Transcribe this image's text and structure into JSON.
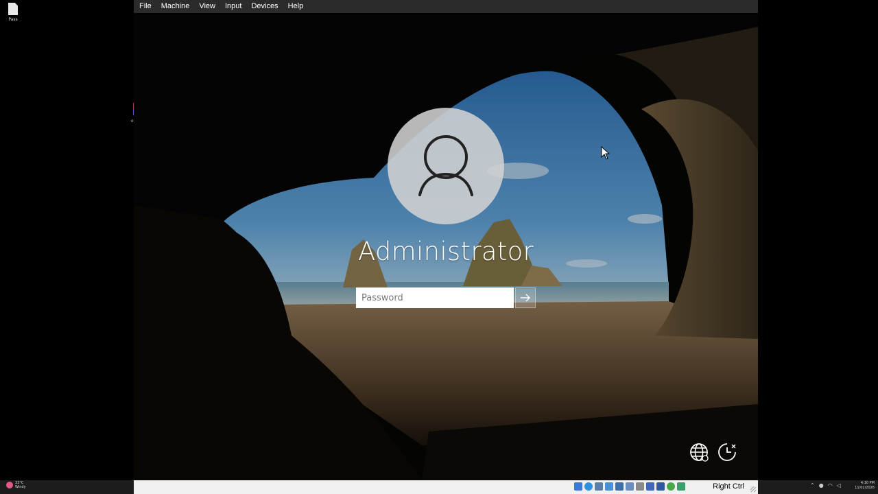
{
  "host": {
    "desktop_icon_label": "Pass",
    "marker_text": "or",
    "weather": {
      "temperature": "33°C",
      "condition": "Windy"
    },
    "tray": {
      "icons": [
        "chevron-up-icon",
        "mic-icon",
        "wifi-icon",
        "volume-icon"
      ]
    },
    "clock": {
      "time": "4:10 PM",
      "date": "11/02/2026"
    }
  },
  "vm": {
    "menu": [
      "File",
      "Machine",
      "View",
      "Input",
      "Devices",
      "Help"
    ],
    "login": {
      "username": "Administrator",
      "password_placeholder": "Password"
    },
    "status_bar": {
      "icons": [
        "hard-disk-icon",
        "optical-drive-icon",
        "audio-icon",
        "network-icon",
        "usb-icon",
        "shared-folder-icon",
        "display-icon",
        "screen-capture-icon",
        "cpu-icon",
        "mouse-integration-icon",
        "keyboard-icon"
      ],
      "host_key": "Right Ctrl"
    }
  },
  "colors": {
    "menubar": "#2b2b2b",
    "status_bar": "#f0f0f0",
    "host_taskbar": "#1c1c1c"
  }
}
